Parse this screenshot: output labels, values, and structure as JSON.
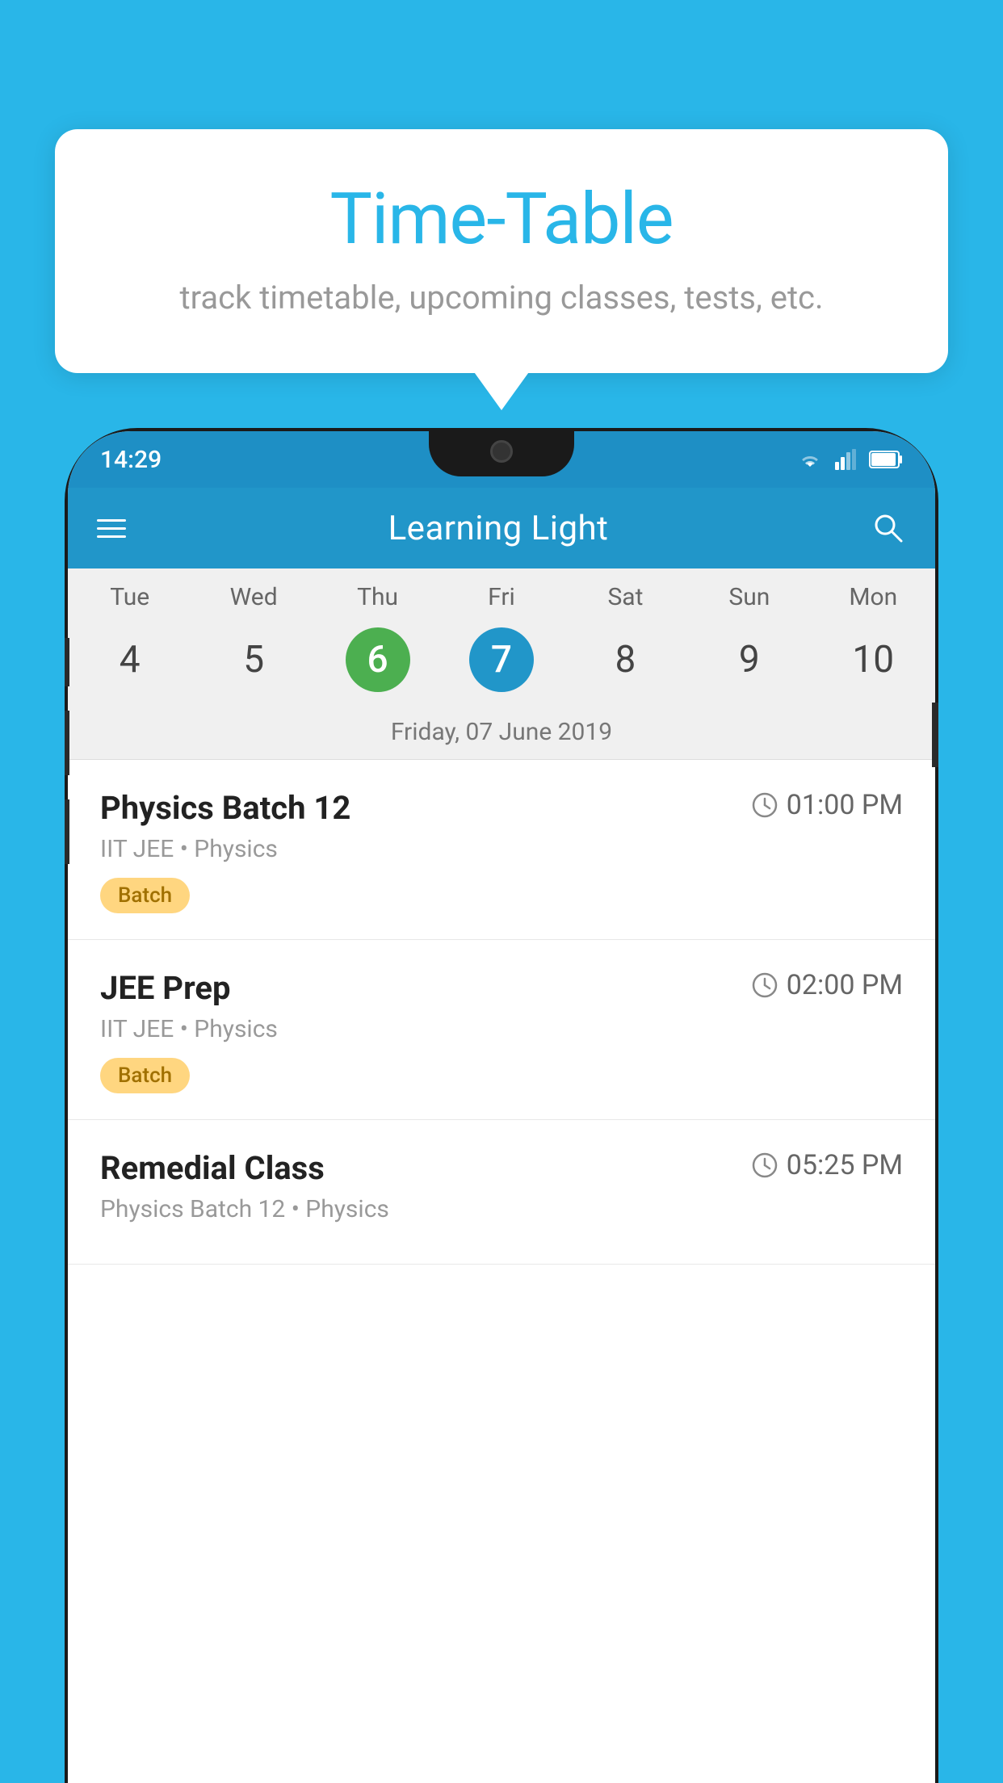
{
  "background_color": "#29b6e8",
  "tooltip": {
    "title": "Time-Table",
    "subtitle": "track timetable, upcoming classes, tests, etc."
  },
  "status_bar": {
    "time": "14:29"
  },
  "app_bar": {
    "title": "Learning Light",
    "search_icon": "search"
  },
  "calendar": {
    "days": [
      "Tue",
      "Wed",
      "Thu",
      "Fri",
      "Sat",
      "Sun",
      "Mon"
    ],
    "dates": [
      {
        "num": "4",
        "state": "normal"
      },
      {
        "num": "5",
        "state": "normal"
      },
      {
        "num": "6",
        "state": "today"
      },
      {
        "num": "7",
        "state": "selected"
      },
      {
        "num": "8",
        "state": "normal"
      },
      {
        "num": "9",
        "state": "normal"
      },
      {
        "num": "10",
        "state": "normal"
      }
    ],
    "selected_date_label": "Friday, 07 June 2019"
  },
  "schedule": {
    "items": [
      {
        "title": "Physics Batch 12",
        "time": "01:00 PM",
        "subtitle": "IIT JEE • Physics",
        "badge": "Batch"
      },
      {
        "title": "JEE Prep",
        "time": "02:00 PM",
        "subtitle": "IIT JEE • Physics",
        "badge": "Batch"
      },
      {
        "title": "Remedial Class",
        "time": "05:25 PM",
        "subtitle": "Physics Batch 12 • Physics",
        "badge": null
      }
    ]
  }
}
